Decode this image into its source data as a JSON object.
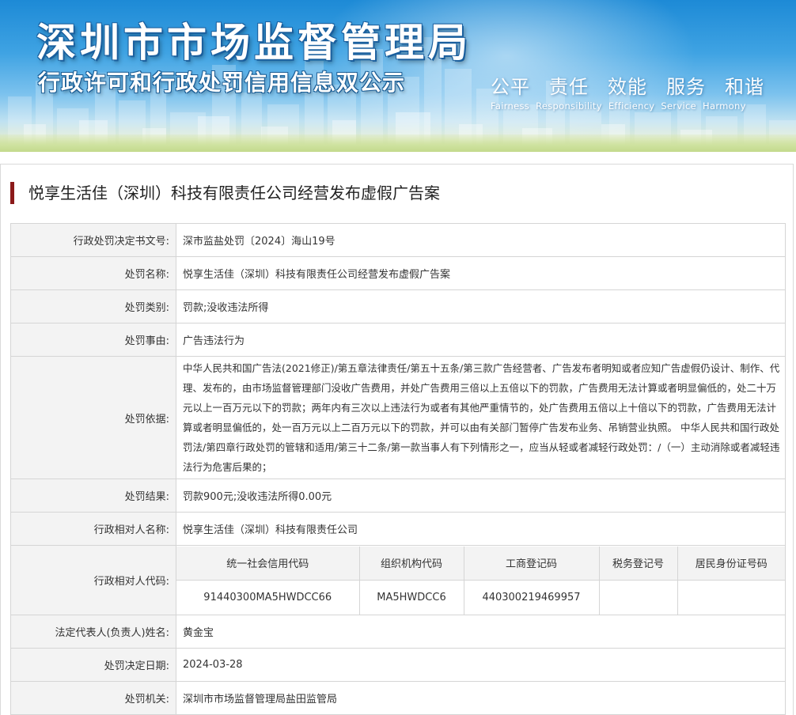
{
  "banner": {
    "title": "深圳市市场监督管理局",
    "subtitle": "行政许可和行政处罚信用信息双公示",
    "motto_cn": [
      "公平",
      "责任",
      "效能",
      "服务",
      "和谐"
    ],
    "motto_en": [
      "Fairness",
      "Responsibility",
      "Efficiency",
      "Service",
      "Harmony"
    ]
  },
  "case": {
    "heading": "悦享生活佳（深圳）科技有限责任公司经营发布虚假广告案"
  },
  "fields": {
    "decision_no_label": "行政处罚决定书文号:",
    "decision_no": "深市监盐处罚〔2024〕海山19号",
    "name_label": "处罚名称:",
    "name": "悦享生活佳（深圳）科技有限责任公司经营发布虚假广告案",
    "category_label": "处罚类别:",
    "category": "罚款;没收违法所得",
    "reason_label": "处罚事由:",
    "reason": "广告违法行为",
    "basis_label": "处罚依据:",
    "basis": "中华人民共和国广告法(2021修正)/第五章法律责任/第五十五条/第三款广告经营者、广告发布者明知或者应知广告虚假仍设计、制作、代理、发布的，由市场监督管理部门没收广告费用，并处广告费用三倍以上五倍以下的罚款，广告费用无法计算或者明显偏低的，处二十万元以上一百万元以下的罚款；两年内有三次以上违法行为或者有其他严重情节的，处广告费用五倍以上十倍以下的罚款，广告费用无法计算或者明显偏低的，处一百万元以上二百万元以下的罚款，并可以由有关部门暂停广告发布业务、吊销营业执照。 中华人民共和国行政处罚法/第四章行政处罚的管辖和适用/第三十二条/第一款当事人有下列情形之一，应当从轻或者减轻行政处罚：/（一）主动消除或者减轻违法行为危害后果的；",
    "result_label": "处罚结果:",
    "result": "罚款900元;没收违法所得0.00元",
    "party_name_label": "行政相对人名称:",
    "party_name": "悦享生活佳（深圳）科技有限责任公司",
    "party_code_label": "行政相对人代码:",
    "legal_rep_label": "法定代表人(负责人)姓名:",
    "legal_rep": "黄金宝",
    "date_label": "处罚决定日期:",
    "date": "2024-03-28",
    "authority_label": "处罚机关:",
    "authority": "深圳市市场监督管理局盐田监管局"
  },
  "codes": {
    "headers": [
      "统一社会信用代码",
      "组织机构代码",
      "工商登记码",
      "税务登记号",
      "居民身份证号码"
    ],
    "values": [
      "91440300MA5HWDCC66",
      "MA5HWDCC6",
      "440300219469957",
      "",
      ""
    ]
  }
}
